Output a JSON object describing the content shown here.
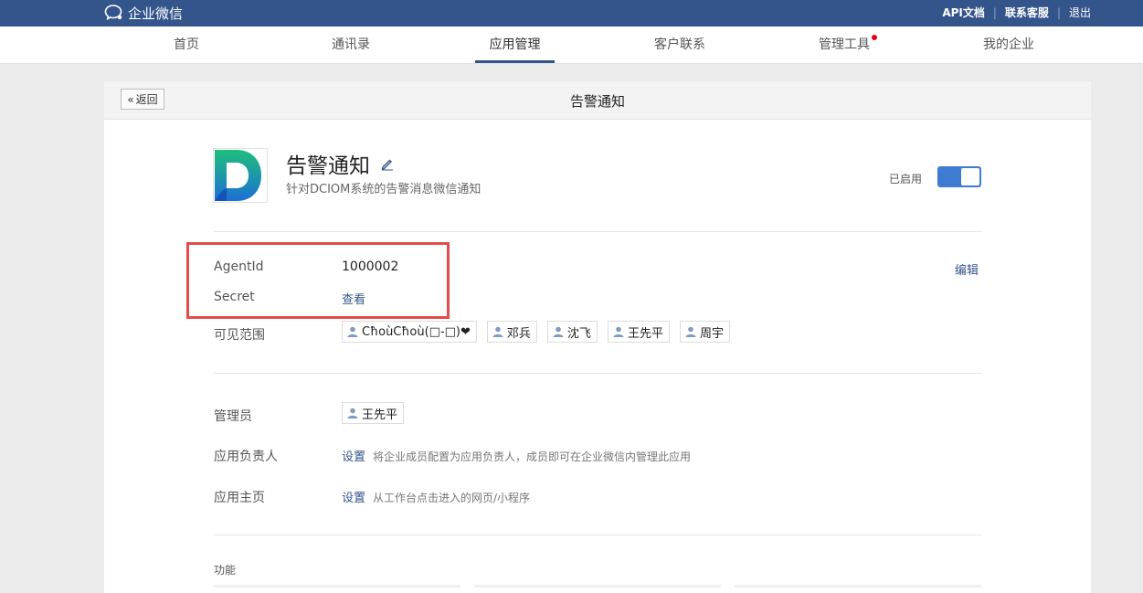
{
  "topbar": {
    "logo_text": "企业微信",
    "links": [
      "API文档",
      "联系客服",
      "退出"
    ]
  },
  "nav": {
    "items": [
      "首页",
      "通讯录",
      "应用管理",
      "客户联系",
      "管理工具",
      "我的企业"
    ],
    "active": "应用管理"
  },
  "page": {
    "back_label": "返回",
    "title": "告警通知"
  },
  "app": {
    "name": "告警通知",
    "description": "针对DCIOM系统的告警消息微信通知",
    "status_label": "已启用",
    "enabled": true
  },
  "credentials": {
    "agentid_label": "AgentId",
    "agentid_value": "1000002",
    "secret_label": "Secret",
    "secret_action": "查看",
    "edit_label": "编辑"
  },
  "visibility": {
    "label": "可见范围",
    "members": [
      "CħoùCħoù(□-□)❤",
      "邓兵",
      "沈飞",
      "王先平",
      "周宇"
    ]
  },
  "admins": {
    "label": "管理员",
    "members": [
      "王先平"
    ]
  },
  "owner": {
    "label": "应用负责人",
    "action": "设置",
    "hint": "将企业成员配置为应用负责人，成员即可在企业微信内管理此应用"
  },
  "homepage": {
    "label": "应用主页",
    "action": "设置",
    "hint": "从工作台点击进入的网页/小程序"
  },
  "features": {
    "label": "功能"
  },
  "colors": {
    "brand": "#34558b",
    "toggle": "#3e7bd1",
    "highlight": "#e34a4a",
    "badge": "#e60012"
  }
}
